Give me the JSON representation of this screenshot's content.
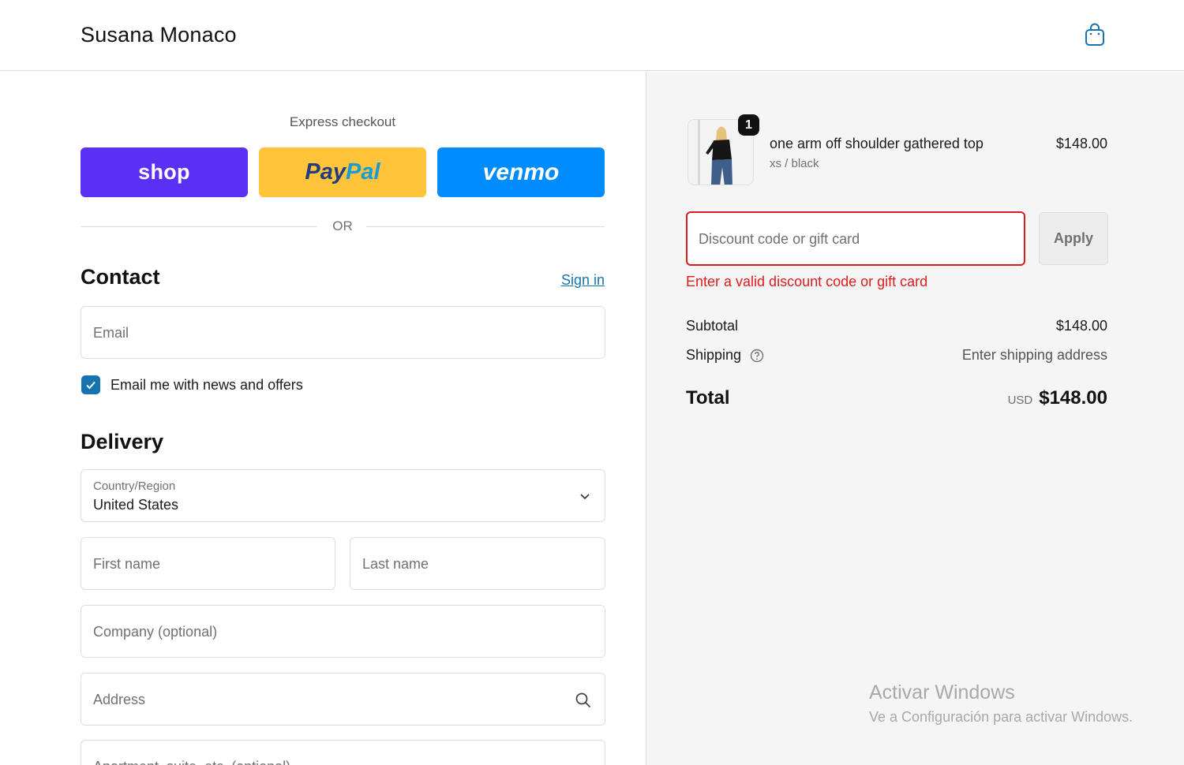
{
  "header": {
    "brand": "Susana Monaco",
    "cart_icon": "shopping-bag-icon"
  },
  "express": {
    "title": "Express checkout",
    "shop_label": "shop",
    "paypal_label_1": "Pay",
    "paypal_label_2": "Pal",
    "venmo_label": "venmo",
    "or_label": "OR"
  },
  "contact": {
    "title": "Contact",
    "sign_in": "Sign in",
    "email_placeholder": "Email",
    "news_label": "Email me with news and offers",
    "news_checked": true
  },
  "delivery": {
    "title": "Delivery",
    "country_label": "Country/Region",
    "country_value": "United States",
    "first_name_placeholder": "First name",
    "last_name_placeholder": "Last name",
    "company_placeholder": "Company (optional)",
    "address_placeholder": "Address",
    "apartment_placeholder": "Apartment, suite, etc. (optional)"
  },
  "summary": {
    "product": {
      "quantity": "1",
      "name": "one arm off shoulder gathered top",
      "variant": "xs / black",
      "price": "$148.00"
    },
    "discount_placeholder": "Discount code or gift card",
    "apply_label": "Apply",
    "discount_error": "Enter a valid discount code or gift card",
    "subtotal_label": "Subtotal",
    "subtotal_value": "$148.00",
    "shipping_label": "Shipping",
    "shipping_value": "Enter shipping address",
    "total_label": "Total",
    "currency": "USD",
    "total_value": "$148.00"
  },
  "watermark": {
    "title": "Activar Windows",
    "subtitle": "Ve a Configuración para activar Windows."
  },
  "colors": {
    "shop": "#5a31f4",
    "paypal": "#ffc439",
    "venmo": "#008cff",
    "link": "#1773b0",
    "error": "#dd1d1d"
  }
}
